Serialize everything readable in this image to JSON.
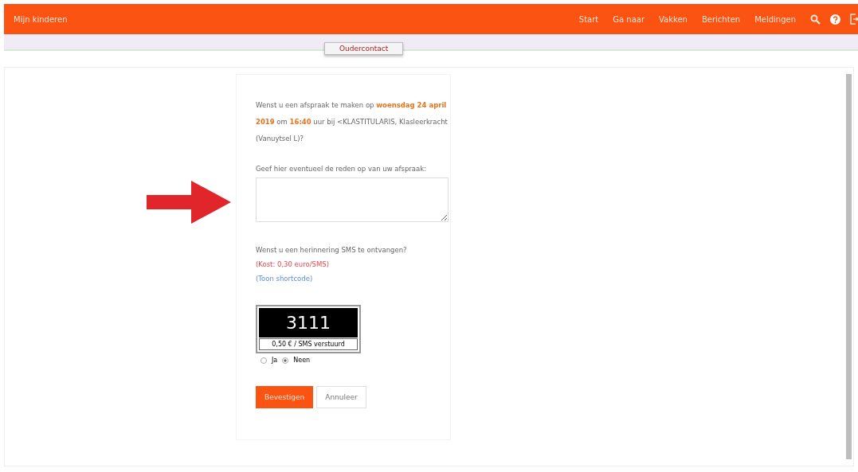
{
  "header": {
    "title": "Mijn kinderen",
    "nav": [
      "Start",
      "Ga naar",
      "Vakken",
      "Berichten",
      "Meldingen"
    ]
  },
  "tab": {
    "label": "Oudercontact"
  },
  "form": {
    "question": "Wenst u een afspraak te maken op **woensdag 24 april 2019** om **16:40** uur bij <KLASTITULARIS, Klasleerkracht (Vanuytsel L)?",
    "reason_label": "Geef hier eventueel de reden op van uw afspraak:",
    "sms_question": "Wenst u een herinnering SMS te ontvangen?",
    "cost": "(Kost: 0,30 euro/SMS)",
    "shortcode": "(Toon shortcode)",
    "sms_number": "3111",
    "sms_caption": "0,50 € / SMS verstuurd",
    "options": [
      {
        "label": "Ja",
        "selected": false
      },
      {
        "label": "Neen",
        "selected": true
      }
    ],
    "buttons": [
      {
        "label": "Bevestigen",
        "kind": "primary"
      },
      {
        "label": "Annuleer",
        "kind": "secondary"
      }
    ]
  }
}
